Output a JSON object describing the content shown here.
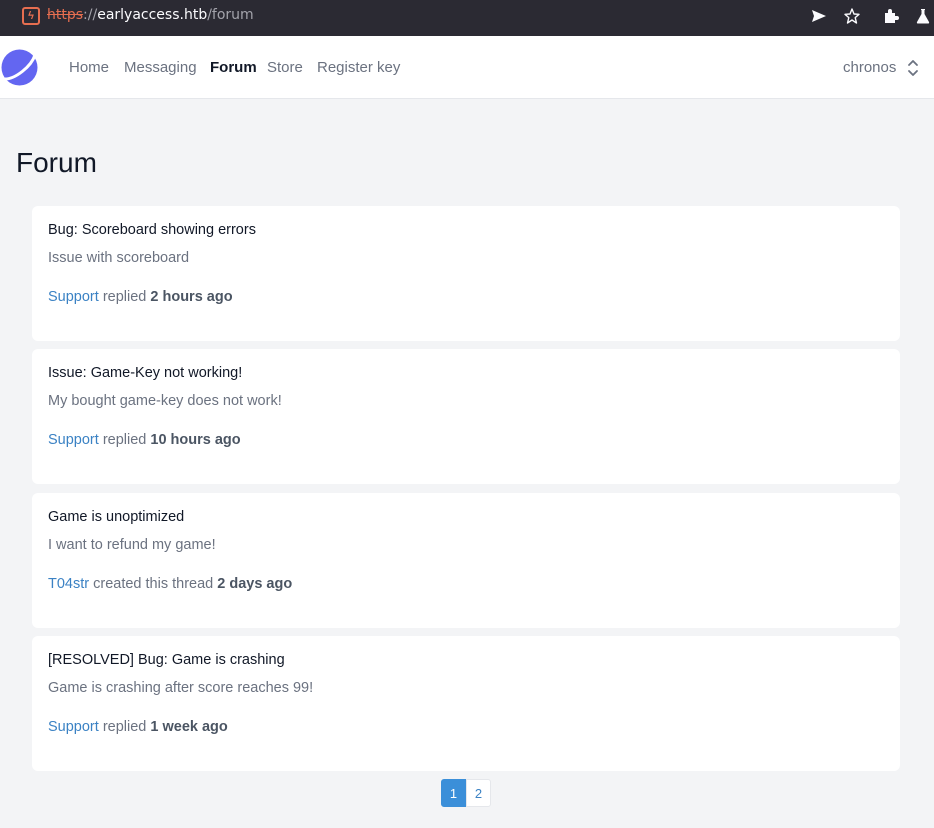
{
  "browser": {
    "url_scheme": "https",
    "url_separator": "://",
    "url_host": "earlyaccess.htb",
    "url_path": "/forum",
    "icons": [
      "send-icon",
      "star-icon",
      "extensions-icon",
      "flask-icon"
    ]
  },
  "nav": {
    "links": [
      {
        "label": "Home",
        "active": false
      },
      {
        "label": "Messaging",
        "active": false
      },
      {
        "label": "Forum",
        "active": true
      },
      {
        "label": "Store",
        "active": false
      },
      {
        "label": "Register key",
        "active": false
      }
    ],
    "username": "chronos"
  },
  "page": {
    "title": "Forum"
  },
  "threads": [
    {
      "title": "Bug: Scoreboard showing errors",
      "description": "Issue with scoreboard",
      "author": "Support",
      "action": "replied",
      "time": "2 hours ago"
    },
    {
      "title": "Issue: Game-Key not working!",
      "description": "My bought game-key does not work!",
      "author": "Support",
      "action": "replied",
      "time": "10 hours ago"
    },
    {
      "title": "Game is unoptimized",
      "description": "I want to refund my game!",
      "author": "T04str",
      "action": "created this thread",
      "time": "2 days ago"
    },
    {
      "title": "[RESOLVED] Bug: Game is crashing",
      "description": "Game is crashing after score reaches 99!",
      "author": "Support",
      "action": "replied",
      "time": "1 week ago"
    }
  ],
  "pagination": {
    "pages": [
      "1",
      "2"
    ],
    "current": "1"
  },
  "colors": {
    "accent": "#3b82c4",
    "logo": "#6366f1",
    "background": "#f3f4f6"
  }
}
